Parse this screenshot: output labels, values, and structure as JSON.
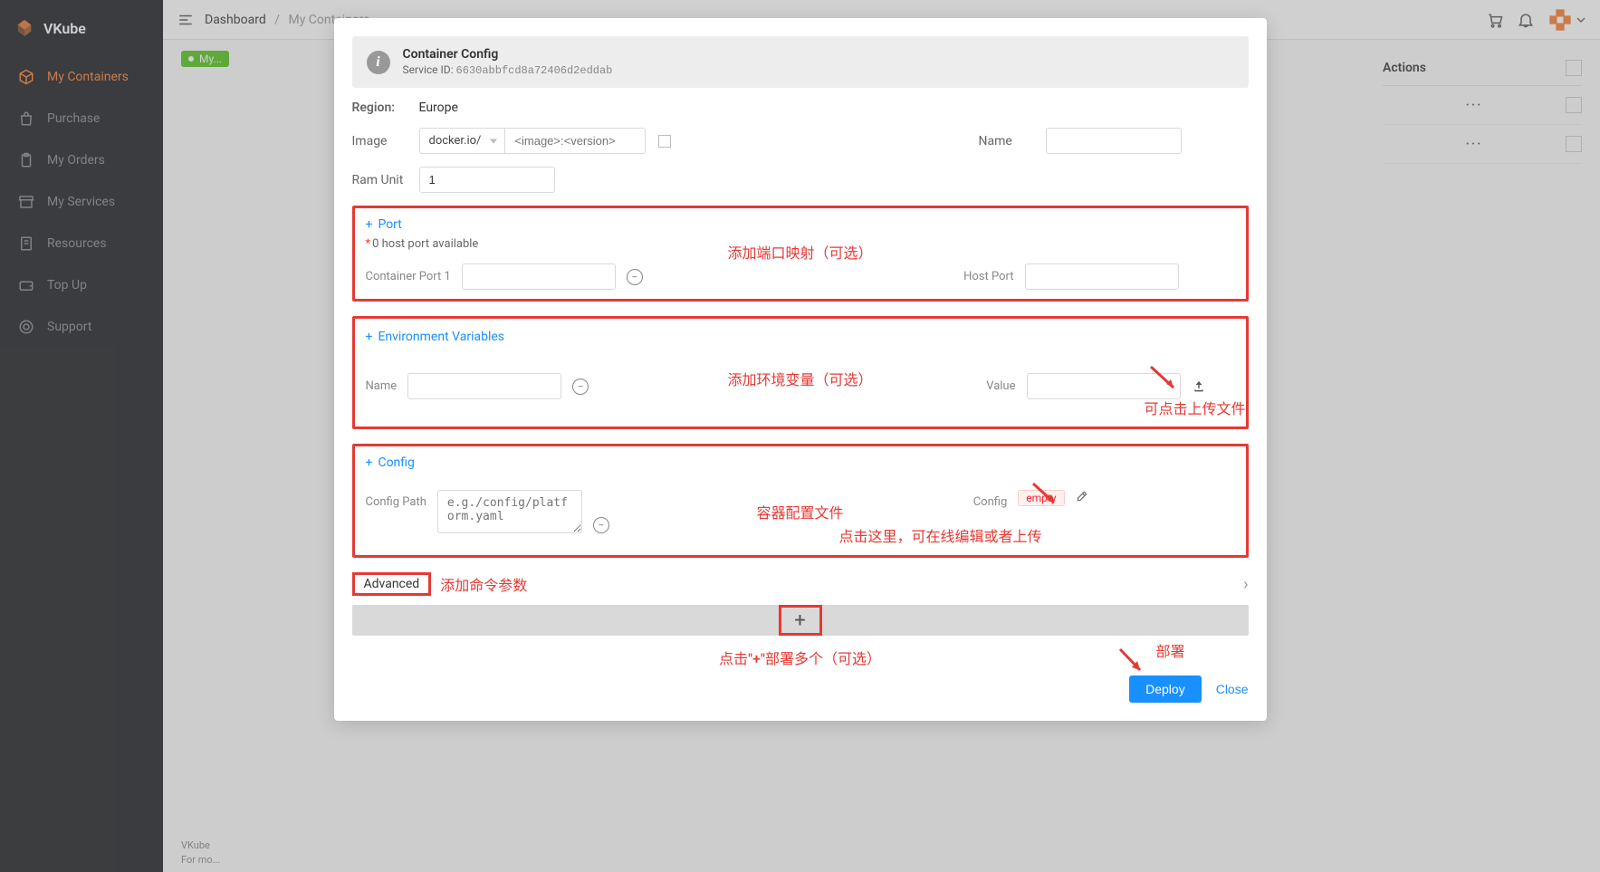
{
  "app": {
    "name": "VKube"
  },
  "sidebar": {
    "items": [
      {
        "label": "My Containers",
        "icon": "cube",
        "active": true
      },
      {
        "label": "Purchase",
        "icon": "bag"
      },
      {
        "label": "My Orders",
        "icon": "clipboard"
      },
      {
        "label": "My Services",
        "icon": "store"
      },
      {
        "label": "Resources",
        "icon": "doc"
      },
      {
        "label": "Top Up",
        "icon": "wallet"
      },
      {
        "label": "Support",
        "icon": "support"
      }
    ]
  },
  "breadcrumb": {
    "root": "Dashboard",
    "current": "My Containers"
  },
  "tag": {
    "label": "My..."
  },
  "table": {
    "actions_header": "Actions"
  },
  "modal": {
    "title": "Container Config",
    "service_id_label": "Service ID:",
    "service_id": "6630abbfcd8a72406d2eddab",
    "region_label": "Region:",
    "region_value": "Europe",
    "image_label": "Image",
    "image_registry": "docker.io/",
    "image_placeholder": "<image>:<version>",
    "name_label": "Name",
    "name_value": "",
    "ram_label": "Ram Unit",
    "ram_value": "1",
    "port": {
      "add_label": "Port",
      "hint": "0 host port available",
      "container_port_label": "Container Port 1",
      "host_port_label": "Host Port"
    },
    "env": {
      "add_label": "Environment Variables",
      "name_label": "Name",
      "value_label": "Value"
    },
    "config": {
      "add_label": "Config",
      "path_label": "Config Path",
      "path_placeholder": "e.g./config/platform.yaml",
      "value_label": "Config",
      "empty_tag": "empty"
    },
    "advanced_label": "Advanced",
    "deploy_label": "Deploy",
    "close_label": "Close"
  },
  "annotations": {
    "port": "添加端口映射（可选）",
    "env": "添加环境变量（可选）",
    "env_upload": "可点击上传文件",
    "config_file": "容器配置文件",
    "config_edit": "点击这里，可在线编辑或者上传",
    "advanced": "添加命令参数",
    "add_multi": "点击\"+\"部署多个（可选）",
    "deploy": "部署"
  },
  "footer": {
    "line1": "VKube",
    "line2": "For mo..."
  }
}
